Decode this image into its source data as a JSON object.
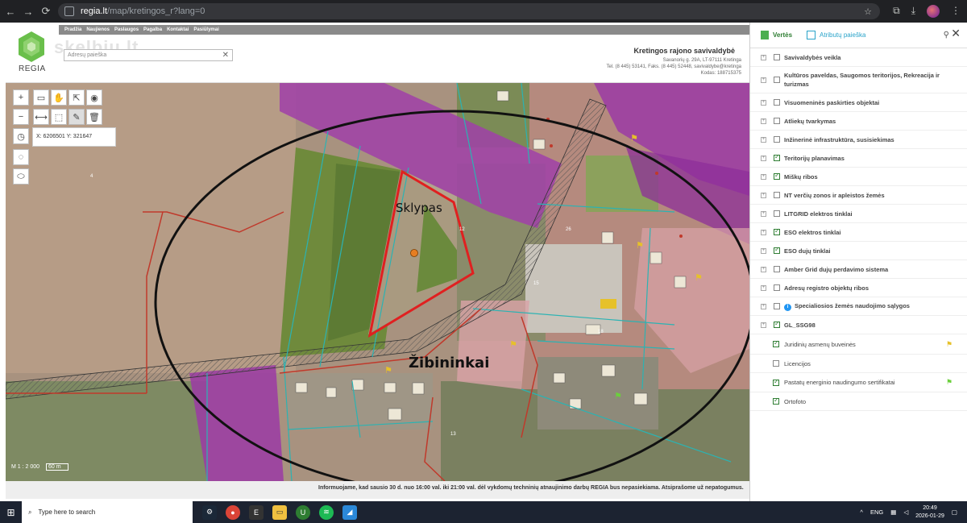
{
  "browser": {
    "url_host": "regia.lt",
    "url_path": "/map/kretingos_r?lang=0"
  },
  "header": {
    "logo_text": "REGIA",
    "watermark": "skelbiu.lt",
    "nav": [
      "Pradžia",
      "Naujienos",
      "Paslaugos",
      "Pagalba",
      "Kontaktai",
      "Pasiūlymai"
    ],
    "search_placeholder": "Adresų paieška",
    "muni_title": "Kretingos rajono savivaldybė",
    "muni_address": "Savanorių g. 29A, LT-97111 Kretinga",
    "muni_contacts": "Tel. (8 445) 53141, Faks. (8 445) 52448, savivaldybe@kretinga",
    "muni_code": "Kodas: 188715375"
  },
  "map": {
    "coords": "X: 6206501 Y: 321647",
    "label_plot": "Sklypas",
    "label_village": "Žibininkai",
    "scale_text": "M 1 : 2 000",
    "scale_bar": "60 m",
    "parcel_numbers": [
      "12",
      "15",
      "18",
      "4",
      "13",
      "26"
    ]
  },
  "notice": "Informuojame, kad sausio 30 d. nuo 16:00 val. iki 21:00 val. dėl vykdomų techninių atnaujinimo darbų REGIA bus nepasiekiama. Atsiprašome už nepatogumus.",
  "panel": {
    "tab_values": "Vertės",
    "tab_search": "Atributų paieška",
    "layers": [
      {
        "label": "Savivaldybės veikla",
        "checked": false,
        "expandable": true,
        "sub": false
      },
      {
        "label": "Kultūros paveldas, Saugomos teritorijos, Rekreacija ir turizmas",
        "checked": false,
        "expandable": true,
        "sub": false
      },
      {
        "label": "Visuomeninės paskirties objektai",
        "checked": false,
        "expandable": true,
        "sub": false
      },
      {
        "label": "Atliekų tvarkymas",
        "checked": false,
        "expandable": true,
        "sub": false
      },
      {
        "label": "Inžinerinė infrastruktūra, susisiekimas",
        "checked": false,
        "expandable": true,
        "sub": false
      },
      {
        "label": "Teritorijų planavimas",
        "checked": true,
        "expandable": true,
        "sub": false
      },
      {
        "label": "Miškų ribos",
        "checked": true,
        "expandable": true,
        "sub": false
      },
      {
        "label": "NT verčių zonos ir apleistos žemės",
        "checked": false,
        "expandable": true,
        "sub": false
      },
      {
        "label": "LITGRID elektros tinklai",
        "checked": false,
        "expandable": true,
        "sub": false
      },
      {
        "label": "ESO elektros tinklai",
        "checked": true,
        "expandable": true,
        "sub": false
      },
      {
        "label": "ESO dujų tinklai",
        "checked": true,
        "expandable": true,
        "sub": false
      },
      {
        "label": "Amber Grid dujų perdavimo sistema",
        "checked": false,
        "expandable": true,
        "sub": false
      },
      {
        "label": "Adresų registro objektų ribos",
        "checked": false,
        "expandable": true,
        "sub": false
      },
      {
        "label": "Specialiosios žemės naudojimo sąlygos",
        "checked": false,
        "expandable": true,
        "sub": false,
        "info": true
      },
      {
        "label": "GL_SSG98",
        "checked": true,
        "expandable": true,
        "sub": false
      },
      {
        "label": "Juridinių asmenų buveinės",
        "checked": true,
        "expandable": false,
        "sub": true,
        "flag": "yellow"
      },
      {
        "label": "Licencijos",
        "checked": false,
        "expandable": false,
        "sub": true
      },
      {
        "label": "Pastatų energinio naudingumo sertifikatai",
        "checked": true,
        "expandable": false,
        "sub": true,
        "flag": "green"
      },
      {
        "label": "Ortofoto",
        "checked": true,
        "expandable": false,
        "sub": true
      }
    ]
  },
  "taskbar": {
    "search_placeholder": "Type here to search",
    "lang": "ENG",
    "time": "20:49",
    "date": "2026-01-29"
  }
}
